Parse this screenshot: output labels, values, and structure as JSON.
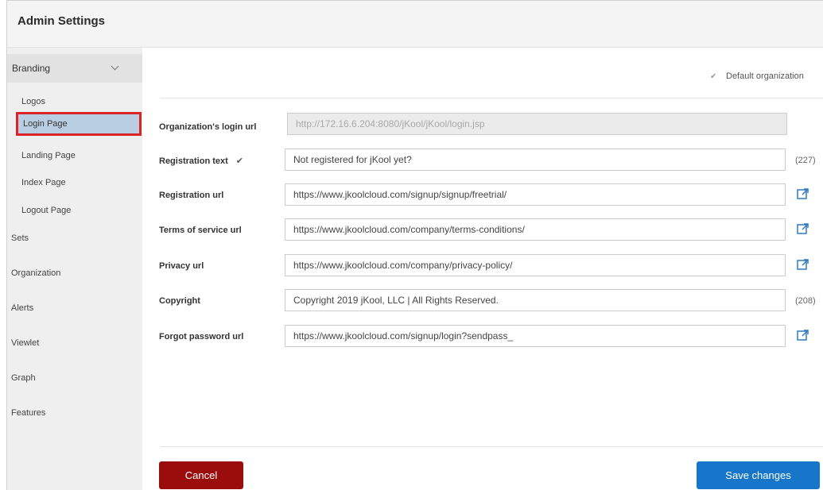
{
  "header": {
    "title": "Admin Settings"
  },
  "sidebar": {
    "group": {
      "label": "Branding"
    },
    "sub_items": [
      "Logos",
      "Login Page",
      "Landing Page",
      "Index Page",
      "Logout Page"
    ],
    "items": [
      "Sets",
      "Organization",
      "Alerts",
      "Viewlet",
      "Graph",
      "Features"
    ]
  },
  "main": {
    "default_org_label": "Default organization",
    "rows": [
      {
        "label": "Organization's login url",
        "value": "http://172.16.6.204:8080/jKool/jKool/login.jsp"
      },
      {
        "label": "Registration text",
        "value": "Not registered for jKool yet?",
        "count": "(227)"
      },
      {
        "label": "Registration url",
        "value": "https://www.jkoolcloud.com/signup/signup/freetrial/"
      },
      {
        "label": "Terms of service url",
        "value": "https://www.jkoolcloud.com/company/terms-conditions/"
      },
      {
        "label": "Privacy url",
        "value": "https://www.jkoolcloud.com/company/privacy-policy/"
      },
      {
        "label": "Copyright",
        "value": "Copyright 2019 jKool, LLC | All Rights Reserved.",
        "count": "(208)"
      },
      {
        "label": "Forgot password url",
        "value": "https://www.jkoolcloud.com/signup/login?sendpass_"
      }
    ],
    "cancel_label": "Cancel",
    "save_label": "Save changes"
  },
  "colors": {
    "cancel": "#9b0d0d",
    "save": "#1776c9",
    "active_item": "#b9cfe1",
    "highlight_border": "#d9232a"
  },
  "icons": {
    "external_link": "external-link-icon",
    "checkbox": "checkbox-icon",
    "chevron": "chevron-down-icon"
  }
}
